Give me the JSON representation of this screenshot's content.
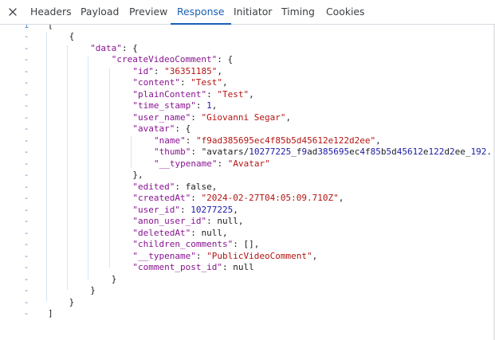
{
  "tabs": [
    {
      "label": "Headers",
      "active": false
    },
    {
      "label": "Payload",
      "active": false
    },
    {
      "label": "Preview",
      "active": false
    },
    {
      "label": "Response",
      "active": true
    },
    {
      "label": "Initiator",
      "active": false
    },
    {
      "label": "Timing",
      "active": false
    },
    {
      "label": "Cookies",
      "active": false
    }
  ],
  "close_icon": "close-icon",
  "colors": {
    "active_tab": "#1a5fb4",
    "key": "#881391",
    "string": "#b31412",
    "number": "#1a1aa6",
    "gutter": "#5f8fc7"
  },
  "response": {
    "gutter": [
      "1",
      "-",
      "-",
      "-",
      "-",
      "-",
      "-",
      "-",
      "-",
      "-",
      "-",
      "-",
      "-",
      "-",
      "-",
      "-",
      "-",
      "-",
      "-",
      "-",
      "-",
      "-",
      "-",
      "-",
      "-",
      "-"
    ],
    "lines": [
      "[",
      "{",
      "\"data\": {",
      "\"createVideoComment\": {",
      "\"id\": \"36351185\",",
      "\"content\": \"Test\",",
      "\"plainContent\": \"Test\",",
      "\"time_stamp\": 1,",
      "\"user_name\": \"Giovanni Segar\",",
      "\"avatar\": {",
      "\"name\": \"f9ad385695ec4f85b5d45612e122d2ee\",",
      "\"thumb\": \"avatars/10277225_f9ad385695ec4f85b5d45612e122d2ee_192.",
      "\"__typename\": \"Avatar\"",
      "},",
      "\"edited\": false,",
      "\"createdAt\": \"2024-02-27T04:05:09.710Z\",",
      "\"user_id\": 10277225,",
      "\"anon_user_id\": null,",
      "\"deletedAt\": null,",
      "\"children_comments\": [],",
      "\"__typename\": \"PublicVideoComment\",",
      "\"comment_post_id\": null",
      "}",
      "}",
      "}",
      "]"
    ]
  }
}
